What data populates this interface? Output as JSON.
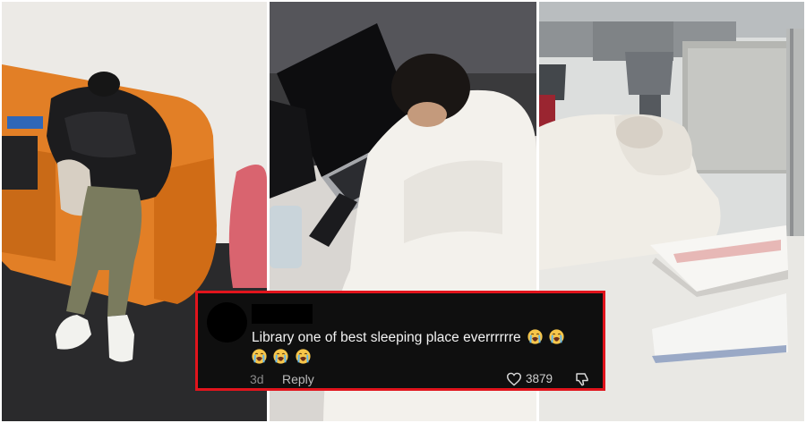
{
  "photos": [
    {
      "subject": "student sleeping on orange armchair"
    },
    {
      "subject": "student sleeping on laptop keyboard"
    },
    {
      "subject": "student sleeping on open textbook"
    }
  ],
  "comment": {
    "text_line": "Library one of best sleeping place everrrrrre",
    "emojis": [
      "loudly-crying-face",
      "loudly-crying-face",
      "loudly-crying-face",
      "loudly-crying-face",
      "loudly-crying-face"
    ],
    "age": "3d",
    "reply_label": "Reply",
    "like_count": "3879"
  },
  "colors": {
    "highlight_border": "#e1141c",
    "card_background": "#0f0f0f",
    "armchair": "#e07a22"
  }
}
